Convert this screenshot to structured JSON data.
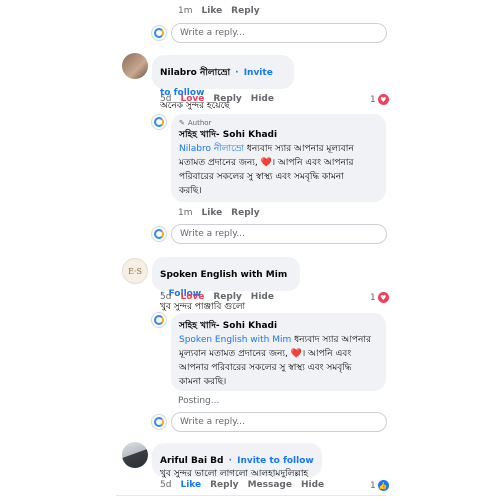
{
  "reply_placeholder": "Write a reply...",
  "top_meta": {
    "time": "1m",
    "like": "Like",
    "reply": "Reply"
  },
  "c1": {
    "name": "Nilabro নীলাভ্রো",
    "invite": "Invite to follow",
    "text": "অনেক সুন্দর হয়েছে",
    "time": "5d",
    "reaction": "Love",
    "reply": "Reply",
    "hide": "Hide",
    "count": "1"
  },
  "r1": {
    "author_tag": "Author",
    "name": "সহিহ খাদি- Sohi Khadi",
    "mention": "Nilabro নীলাভ্রো",
    "text_a": " ধন্যবাদ স্যার আপনার মূল্যবান",
    "text_b": "মতামত প্রদানের জন্য, ",
    "text_c": "। আপনি এবং আপনার",
    "text_d": "পরিবারের সকলের সু স্বাস্থ্য এবং সমবৃদ্ধি কামনা",
    "text_e": "করছি।",
    "time": "1m",
    "like": "Like",
    "reply": "Reply"
  },
  "c2": {
    "name": "Spoken English with Mim",
    "invite": "Follow",
    "text": "খুব সুন্দর পাঞ্জাবি গুলো",
    "time": "5d",
    "reaction": "Love",
    "reply": "Reply",
    "hide": "Hide",
    "count": "1"
  },
  "r2": {
    "name": "সহিহ খাদি- Sohi Khadi",
    "mention": "Spoken English with Mim",
    "text_a": " ধন্যবাদ স্যার আপনার",
    "text_b": "মূল্যবান মতামত প্রদানের জন্য, ",
    "text_c": "। আপনি এবং",
    "text_d": "আপনার পরিবারের সকলের সু স্বাস্থ্য এবং সমবৃদ্ধি",
    "text_e": "কামনা করছি।",
    "posting": "Posting..."
  },
  "c3": {
    "name": "Ariful Bai Bd",
    "invite": "Invite to follow",
    "text": "খুব সুন্দর ভালো লাগলো আলহামদুলিল্লাহ",
    "time": "5d",
    "reaction": "Like",
    "reply": "Reply",
    "message": "Message",
    "hide": "Hide",
    "count": "1"
  },
  "colors": {
    "accent": "#1877f2",
    "love": "#f33e58",
    "bubble": "#f0f2f5"
  }
}
